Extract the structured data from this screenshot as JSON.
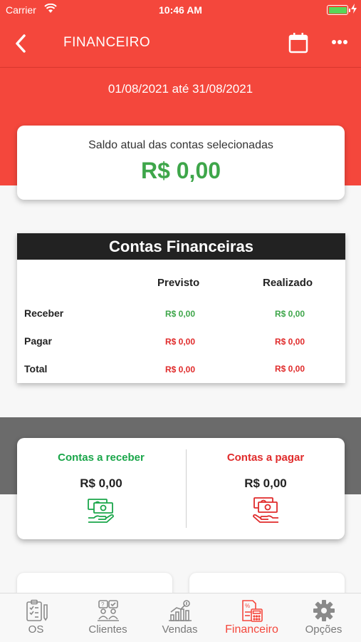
{
  "status_bar": {
    "carrier": "Carrier",
    "time": "10:46 AM"
  },
  "nav": {
    "title": "FINANCEIRO",
    "back_icon": "chevron-left-icon",
    "calendar_icon": "calendar-icon",
    "more_icon": "more-horizontal-icon"
  },
  "period": {
    "label": "01/08/2021 até 31/08/2021"
  },
  "saldo": {
    "label": "Saldo atual das contas selecionadas",
    "value": "R$ 0,00"
  },
  "contas": {
    "title": "Contas Financeiras",
    "columns": [
      "Previsto",
      "Realizado"
    ],
    "rows": [
      {
        "label": "Receber",
        "previsto": "R$ 0,00",
        "realizado": "R$ 0,00"
      },
      {
        "label": "Pagar",
        "previsto": "R$ 0,00",
        "realizado": "R$ 0,00"
      },
      {
        "label": "Total",
        "previsto": "R$ 0,00",
        "realizado": "R$ 0,00"
      }
    ]
  },
  "resumo": {
    "receber": {
      "label": "Contas a receber",
      "value": "R$ 0,00"
    },
    "pagar": {
      "label": "Contas a pagar",
      "value": "R$ 0,00"
    }
  },
  "tabs": [
    {
      "label": "OS",
      "icon": "clipboard-icon"
    },
    {
      "label": "Clientes",
      "icon": "clients-icon"
    },
    {
      "label": "Vendas",
      "icon": "sales-chart-icon"
    },
    {
      "label": "Financeiro",
      "icon": "finance-icon",
      "active": true
    },
    {
      "label": "Opções",
      "icon": "gear-icon"
    }
  ],
  "colors": {
    "brand_red": "#f4473c",
    "green": "#3ea64a",
    "receivable_green": "#1aa64a",
    "payable_red": "#e02b2b",
    "header_dark": "#222222"
  }
}
